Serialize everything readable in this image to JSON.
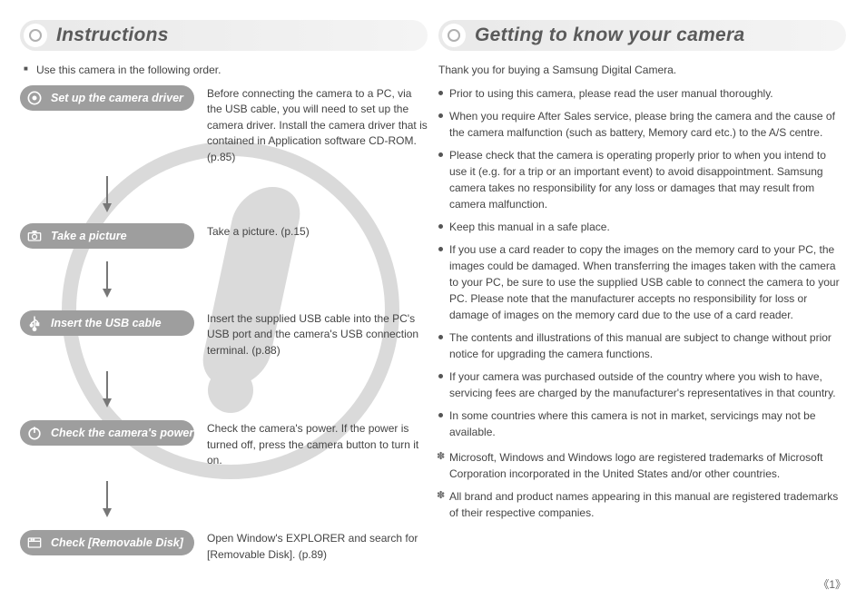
{
  "left": {
    "title": "Instructions",
    "intro": "Use this camera in the following order.",
    "steps": [
      {
        "icon": "cd-icon",
        "label": "Set up the camera driver",
        "desc": "Before connecting the camera to a PC, via the USB cable, you will need to set up the camera driver. Install the camera driver that is contained in Application software CD-ROM. (p.85)"
      },
      {
        "icon": "camera-icon",
        "label": "Take a picture",
        "desc": "Take a picture. (p.15)"
      },
      {
        "icon": "usb-icon",
        "label": "Insert the USB cable",
        "desc": "Insert the supplied USB cable into the PC's USB port and the camera's USB connection terminal. (p.88)"
      },
      {
        "icon": "power-icon",
        "label": "Check the camera's power",
        "desc": "Check the camera's power. If the power is turned off, press the camera button to turn it on."
      },
      {
        "icon": "disk-icon",
        "label": "Check [Removable Disk]",
        "desc": "Open Window's EXPLORER and search for [Removable Disk]. (p.89)"
      }
    ]
  },
  "right": {
    "title": "Getting to know your camera",
    "thanks": "Thank you for buying a Samsung Digital Camera.",
    "bullets": [
      "Prior to using this camera, please read the user manual thoroughly.",
      "When you require After Sales service, please bring the camera and the cause of the camera malfunction (such as battery, Memory card etc.) to the A/S centre.",
      "Please check that the camera is operating properly prior to when you intend to use it (e.g. for a trip or an important event) to avoid disappointment. Samsung camera takes no responsibility for any loss or damages that may result from camera malfunction.",
      "Keep this manual in a safe place.",
      "If you use a card reader to copy the images on the memory card to your PC, the images could be damaged. When transferring the images taken with the camera to your PC, be sure to use the supplied USB cable to connect the camera to your PC. Please note that the manufacturer accepts no responsibility for loss or damage of images on the memory card due to the use of a card reader.",
      "The contents and illustrations of this manual are subject to change without prior notice for upgrading the camera functions.",
      "If your camera was purchased outside of the country where you wish to have, servicing fees are charged by the manufacturer's representatives in that country.",
      "In some countries where this camera is not in market,  servicings may not be available."
    ],
    "notes": [
      "Microsoft, Windows and Windows logo are registered trademarks of Microsoft Corporation incorporated in the United States and/or other countries.",
      "All brand and product names appearing in this manual are registered trademarks of their respective companies."
    ]
  },
  "page_number": "《1》"
}
